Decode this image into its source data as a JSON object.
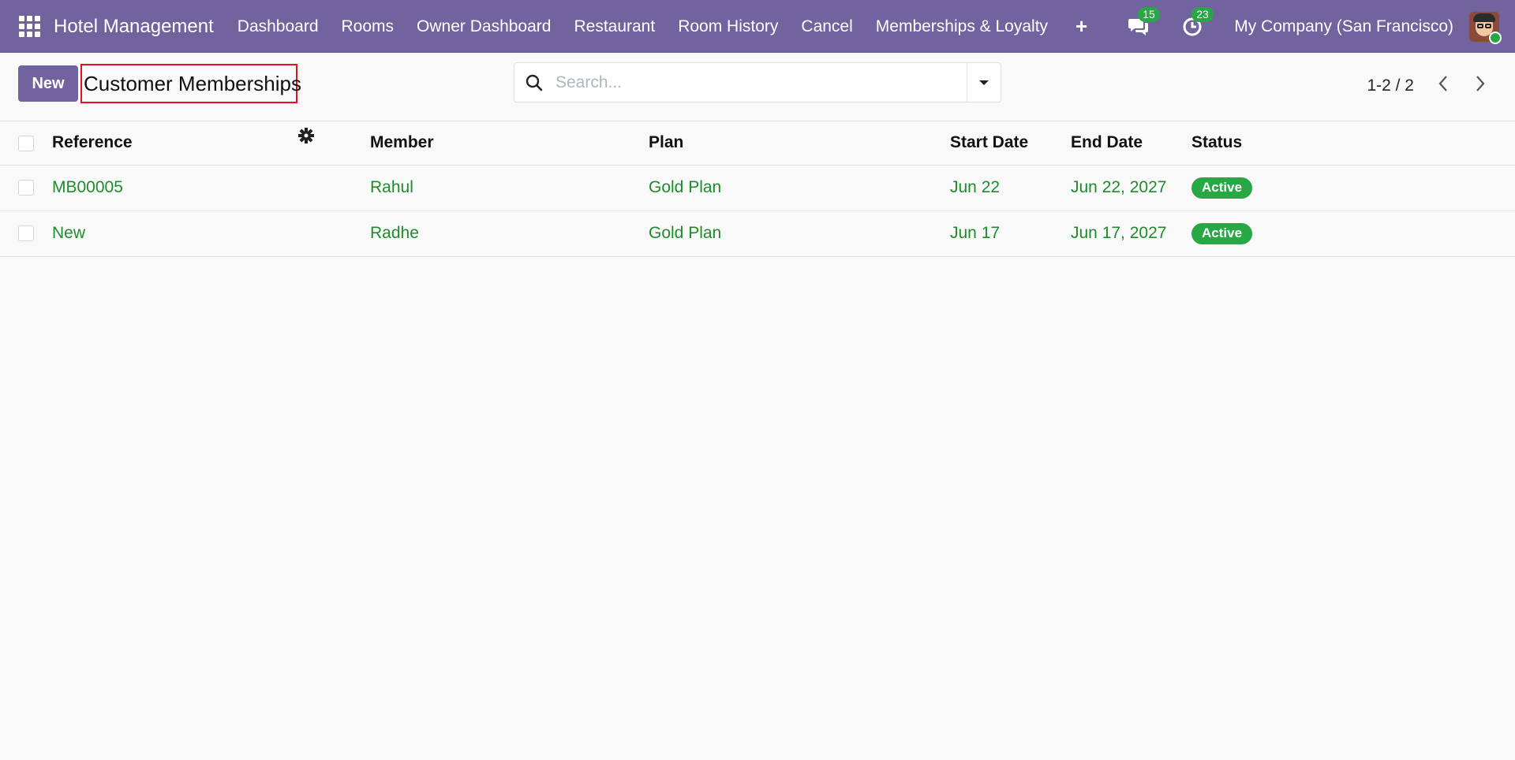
{
  "navbar": {
    "brand": "Hotel Management",
    "menu": [
      {
        "label": "Dashboard"
      },
      {
        "label": "Rooms"
      },
      {
        "label": "Owner Dashboard"
      },
      {
        "label": "Restaurant"
      },
      {
        "label": "Room History"
      },
      {
        "label": "Cancel"
      },
      {
        "label": "Memberships & Loyalty"
      }
    ],
    "plus_label": "+",
    "messages_count": "15",
    "activities_count": "23",
    "company": "My Company (San Francisco)",
    "accent_color": "#71639e"
  },
  "control_panel": {
    "new_label": "New",
    "title": "Customer Memberships",
    "search_placeholder": "Search...",
    "pager": "1-2 / 2"
  },
  "table": {
    "columns": [
      "Reference",
      "Member",
      "Plan",
      "Start Date",
      "End Date",
      "Status"
    ],
    "rows": [
      {
        "reference": "MB00005",
        "member": "Rahul",
        "plan": "Gold Plan",
        "start_date": "Jun 22",
        "end_date": "Jun 22, 2027",
        "status": "Active"
      },
      {
        "reference": "New",
        "member": "Radhe",
        "plan": "Gold Plan",
        "start_date": "Jun 17",
        "end_date": "Jun 17, 2027",
        "status": "Active"
      }
    ],
    "status_color": "#28a745",
    "link_color": "#1e8c2a"
  }
}
